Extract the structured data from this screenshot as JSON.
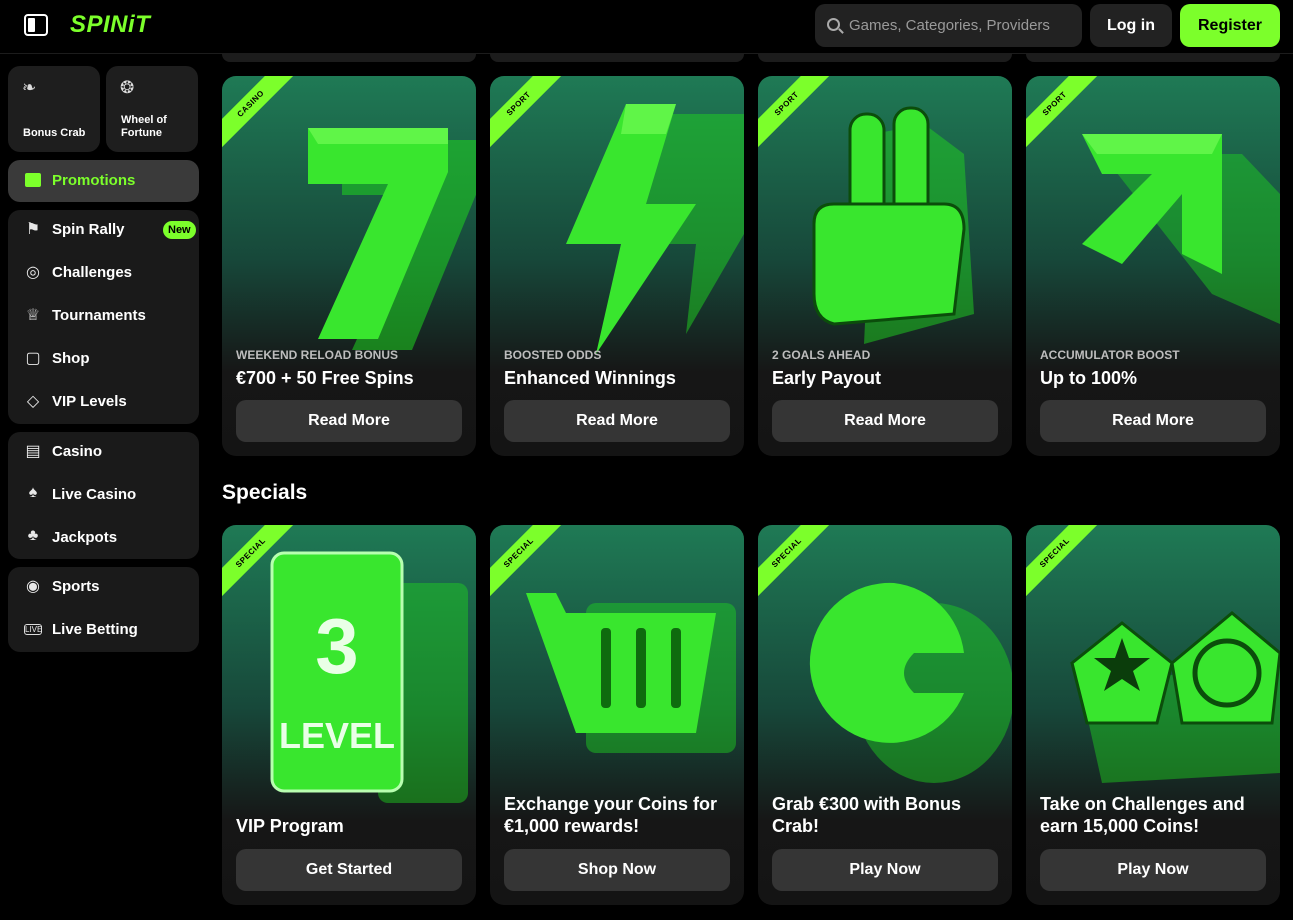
{
  "header": {
    "logo": "SPINiT",
    "search_placeholder": "Games, Categories, Providers",
    "login_label": "Log in",
    "register_label": "Register"
  },
  "sidebar": {
    "tiles": [
      {
        "label": "Bonus Crab",
        "icon": "crab-claw-icon"
      },
      {
        "label": "Wheel of Fortune",
        "icon": "wheel-icon"
      }
    ],
    "promotions_label": "Promotions",
    "group1": [
      {
        "label": "Spin Rally",
        "badge": "New"
      },
      {
        "label": "Challenges"
      },
      {
        "label": "Tournaments"
      },
      {
        "label": "Shop"
      },
      {
        "label": "VIP Levels"
      }
    ],
    "group2": [
      {
        "label": "Casino"
      },
      {
        "label": "Live Casino"
      },
      {
        "label": "Jackpots"
      }
    ],
    "group3": [
      {
        "label": "Sports"
      },
      {
        "label": "Live Betting"
      }
    ]
  },
  "promotions": [
    {
      "ribbon": "CASINO",
      "subtitle": "WEEKEND RELOAD BONUS",
      "title": "€700 + 50 Free Spins",
      "button": "Read More",
      "art": "seven-icon"
    },
    {
      "ribbon": "SPORT",
      "subtitle": "BOOSTED ODDS",
      "title": "Enhanced Winnings",
      "button": "Read More",
      "art": "lightning-icon"
    },
    {
      "ribbon": "SPORT",
      "subtitle": "2 GOALS AHEAD",
      "title": "Early Payout",
      "button": "Read More",
      "art": "victory-hand-icon"
    },
    {
      "ribbon": "SPORT",
      "subtitle": "ACCUMULATOR BOOST",
      "title": "Up to 100%",
      "button": "Read More",
      "art": "arrow-up-icon"
    }
  ],
  "specials": {
    "title": "Specials",
    "cards": [
      {
        "ribbon": "SPECIAL",
        "title": "VIP Program",
        "button": "Get Started",
        "art_number": "3",
        "art_text": "LEVEL"
      },
      {
        "ribbon": "SPECIAL",
        "title": "Exchange your Coins for €1,000 rewards!",
        "button": "Shop Now",
        "art": "shopping-cart-icon"
      },
      {
        "ribbon": "SPECIAL",
        "title": "Grab €300 with Bonus Crab!",
        "button": "Play Now",
        "art": "crab-claw-icon"
      },
      {
        "ribbon": "SPECIAL",
        "title": "Take on Challenges and earn 15,000 Coins!",
        "button": "Play Now",
        "art": "star-ball-icon"
      }
    ]
  },
  "colors": {
    "accent": "#7cff2b",
    "background": "#000000",
    "panel": "#1a1a1a"
  }
}
